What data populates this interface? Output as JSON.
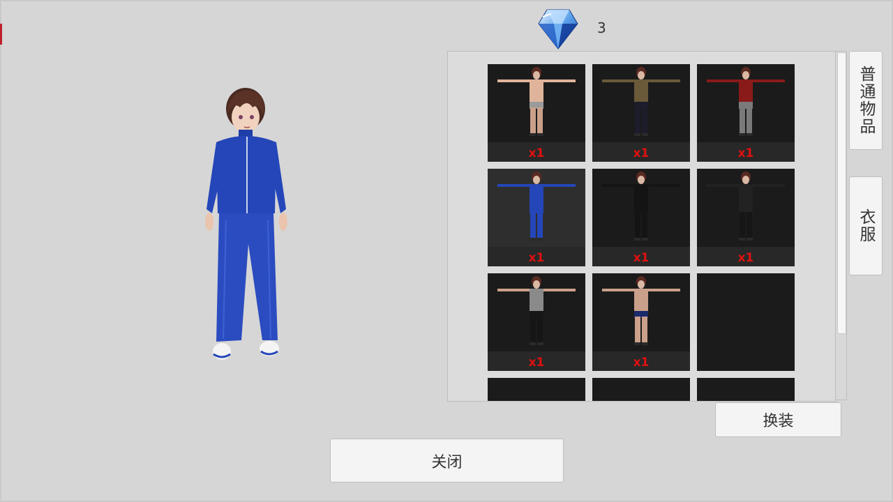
{
  "currency": {
    "icon": "diamond-icon",
    "count": "3",
    "color": "#3a7bd5"
  },
  "character": {
    "outfit": "blue tracksuit"
  },
  "inventory": {
    "slots": [
      {
        "outfit": "swimwear",
        "count": "x1"
      },
      {
        "outfit": "brown blazer uniform",
        "count": "x1"
      },
      {
        "outfit": "red jacket",
        "count": "x1"
      },
      {
        "outfit": "blue tracksuit",
        "count": "x1",
        "selected": true
      },
      {
        "outfit": "black gakuran",
        "count": "x1"
      },
      {
        "outfit": "black long coat",
        "count": "x1"
      },
      {
        "outfit": "grey t-shirt",
        "count": "x1"
      },
      {
        "outfit": "navy swim trunks",
        "count": "x1"
      },
      {
        "outfit": "",
        "count": ""
      }
    ],
    "count_color": "#e01010"
  },
  "tabs": {
    "normal_items": "普通物品",
    "clothes": "衣服"
  },
  "buttons": {
    "change_outfit": "换装",
    "close": "关闭"
  }
}
